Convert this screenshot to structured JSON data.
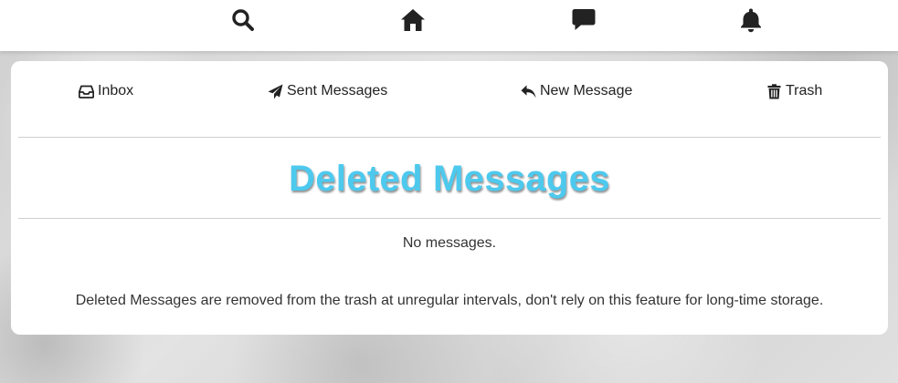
{
  "topnav": {
    "icons": [
      "search-icon",
      "home-icon",
      "chat-icon",
      "bell-icon"
    ]
  },
  "tabs": [
    {
      "label": "Inbox",
      "icon": "inbox-icon"
    },
    {
      "label": "Sent Messages",
      "icon": "paper-plane-icon"
    },
    {
      "label": "New Message",
      "icon": "reply-icon"
    },
    {
      "label": "Trash",
      "icon": "trash-icon"
    }
  ],
  "main": {
    "title": "Deleted Messages",
    "empty_text": "No messages.",
    "note": "Deleted Messages are removed from the trash at unregular intervals, don't rely on this feature for long-time storage."
  },
  "colors": {
    "title": "#4dc9ee",
    "icons": "#222222"
  }
}
